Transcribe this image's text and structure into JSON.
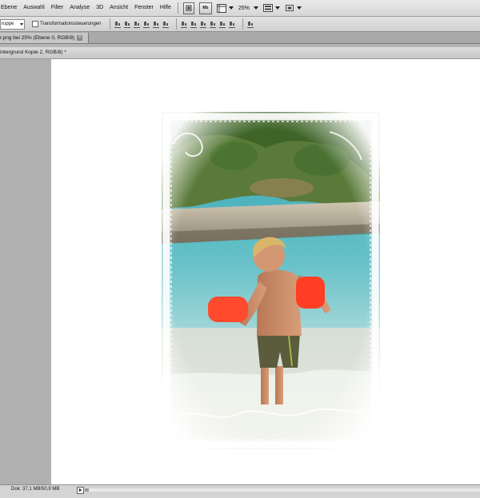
{
  "menubar": {
    "items": [
      "Ebene",
      "Auswahl",
      "Filter",
      "Analyse",
      "3D",
      "Ansicht",
      "Fenster",
      "Hilfe"
    ],
    "mb_label": "Mb",
    "zoom": "25%"
  },
  "options": {
    "group_select": "ruppe",
    "transform_label": "Transformationssteuerungen"
  },
  "tabs": {
    "doc_tab": "r.png bei 25% (Ebene 0, RGB/8)"
  },
  "document": {
    "title": "intergrund Kopie 2, RGB/8) *"
  },
  "status": {
    "doc_info": "Dok: 37,1 MB/50,9 MB"
  }
}
